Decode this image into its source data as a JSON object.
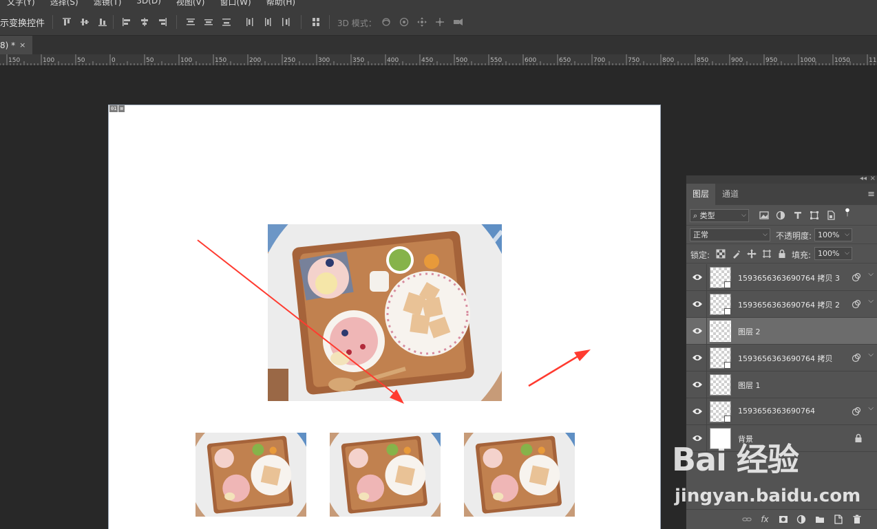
{
  "menu": {
    "items": [
      "文字(Y)",
      "选择(S)",
      "滤镜(T)",
      "3D(D)",
      "视图(V)",
      "窗口(W)",
      "帮助(H)"
    ]
  },
  "options_bar": {
    "show_transform_label": "示变换控件",
    "mode_3d_label": "3D 模式："
  },
  "document_tab": {
    "title": "8) *",
    "close_glyph": "×"
  },
  "ruler": {
    "labels": [
      "150",
      "100",
      "50",
      "0",
      "50",
      "100",
      "150",
      "200",
      "250",
      "300",
      "350",
      "400",
      "450",
      "500",
      "550",
      "600",
      "650",
      "700",
      "750",
      "800",
      "850",
      "900",
      "950",
      "1000",
      "1050",
      "11"
    ]
  },
  "canvas": {
    "slice_badge": [
      "01",
      "⊠"
    ],
    "annotation_arrow_color": "#ff3b30"
  },
  "layers_panel": {
    "tabs": [
      "图层",
      "通道"
    ],
    "active_tab": "图层",
    "filter": {
      "label": "类型"
    },
    "blend_mode": "正常",
    "opacity_label": "不透明度:",
    "opacity_value": "100%",
    "lock_label": "锁定:",
    "fill_label": "填充:",
    "fill_value": "100%",
    "layers": [
      {
        "name": "1593656363690764 拷贝 3",
        "selected": false
      },
      {
        "name": "1593656363690764 拷贝 2",
        "selected": false
      },
      {
        "name": "图层 2",
        "selected": true
      },
      {
        "name": "1593656363690764 拷贝",
        "selected": false
      },
      {
        "name": "图层 1",
        "selected": false
      },
      {
        "name": "1593656363690764",
        "selected": false
      },
      {
        "name": "背景",
        "selected": false
      }
    ],
    "footer_fx": "fx"
  },
  "watermark": {
    "brand": "Bai 经验",
    "url": "jingyan.baidu.com"
  }
}
